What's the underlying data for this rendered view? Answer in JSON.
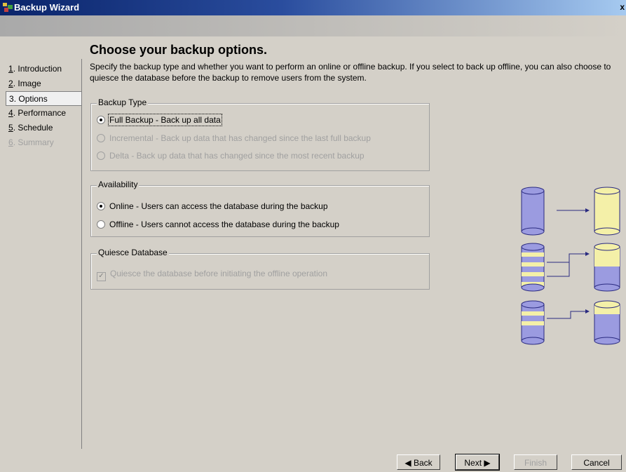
{
  "window": {
    "title": "Backup Wizard",
    "close_glyph": "x"
  },
  "nav": {
    "items": [
      {
        "num": "1",
        "label": ". Introduction",
        "state": "normal"
      },
      {
        "num": "2",
        "label": ". Image",
        "state": "normal"
      },
      {
        "num": "3",
        "label": ". Options",
        "state": "active"
      },
      {
        "num": "4",
        "label": ". Performance",
        "state": "normal"
      },
      {
        "num": "5",
        "label": ". Schedule",
        "state": "normal"
      },
      {
        "num": "6",
        "label": ". Summary",
        "state": "disabled"
      }
    ]
  },
  "page": {
    "heading": "Choose your backup options.",
    "description": "Specify the backup type and whether you want to perform an online or offline backup.  If you select to back up offline, you can also choose to quiesce the database before the backup to remove users from the system."
  },
  "backup_type": {
    "label": "Backup Type",
    "options": [
      {
        "text": "Full Backup  -  Back up all data",
        "checked": true,
        "enabled": true
      },
      {
        "text": "Incremental  -  Back up data that has changed since the last full backup",
        "checked": false,
        "enabled": false
      },
      {
        "text": "Delta  -  Back up data that has changed since the most recent backup",
        "checked": false,
        "enabled": false
      }
    ]
  },
  "availability": {
    "label": "Availability",
    "options": [
      {
        "text": "Online  -  Users can access the database during the backup",
        "checked": true,
        "enabled": true
      },
      {
        "text": "Offline  -  Users cannot access the database during the backup",
        "checked": false,
        "enabled": true
      }
    ]
  },
  "quiesce": {
    "label": "Quiesce Database",
    "checkbox_text": "Quiesce the database before initiating the offline operation",
    "checked": true,
    "enabled": false
  },
  "buttons": {
    "back": "◀ Back",
    "next": "Next ▶",
    "finish": "Finish",
    "cancel": "Cancel"
  },
  "colors": {
    "db_blue": "#9b9be0",
    "db_yellow": "#f4f0a8",
    "db_stroke": "#2a2a80"
  }
}
